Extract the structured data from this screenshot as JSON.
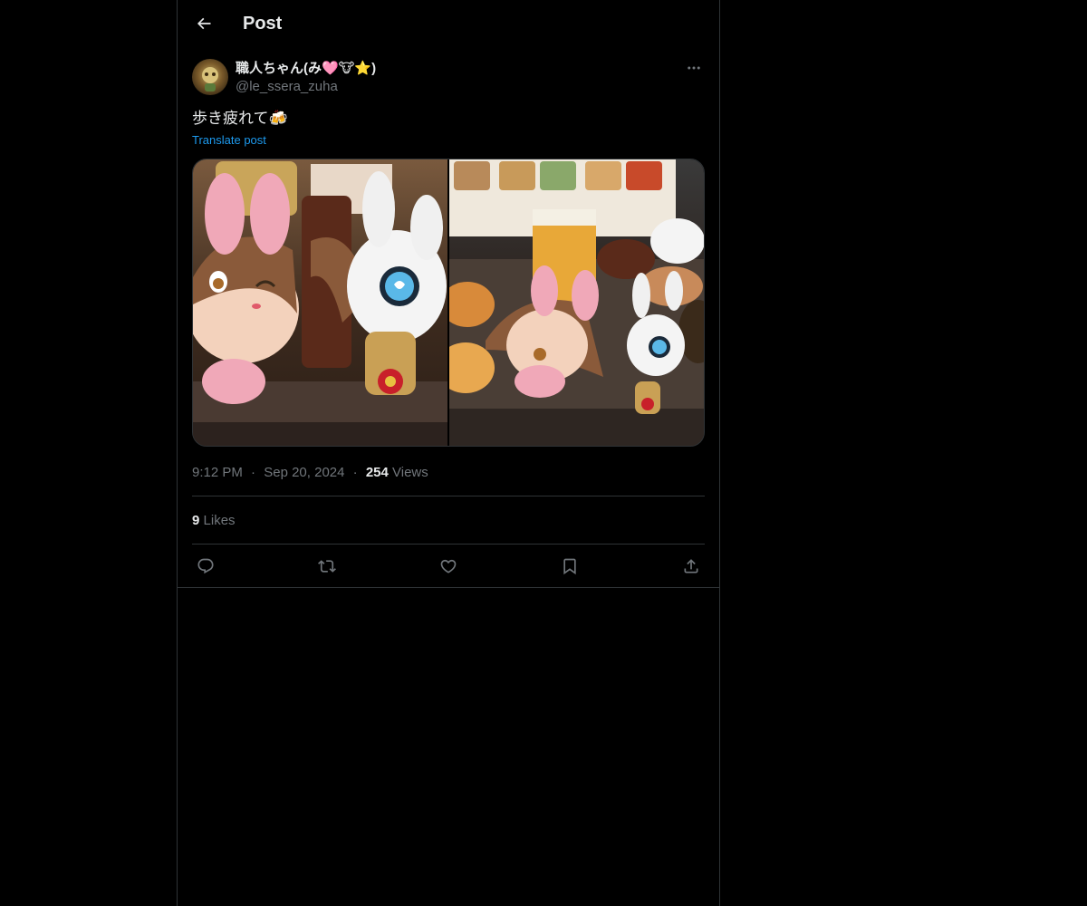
{
  "header": {
    "title": "Post"
  },
  "author": {
    "display_name": "職人ちゃん(み🩷🐮⭐️)",
    "handle": "@le_ssera_zuha"
  },
  "post": {
    "text": "歩き疲れて🍻",
    "translate_label": "Translate post",
    "time": "9:12 PM",
    "date": "Sep 20, 2024",
    "separator": "·",
    "views_count": "254",
    "views_label": "Views",
    "likes_count": "9",
    "likes_label": "Likes"
  },
  "icons": {
    "back": "back-arrow-icon",
    "more": "more-dots-icon",
    "reply": "reply-icon",
    "repost": "repost-icon",
    "like": "heart-icon",
    "bookmark": "bookmark-icon",
    "share": "share-icon"
  },
  "colors": {
    "background": "#000000",
    "border": "#2f3336",
    "text_primary": "#e7e9ea",
    "text_secondary": "#71767b",
    "accent": "#1d9bf0"
  }
}
